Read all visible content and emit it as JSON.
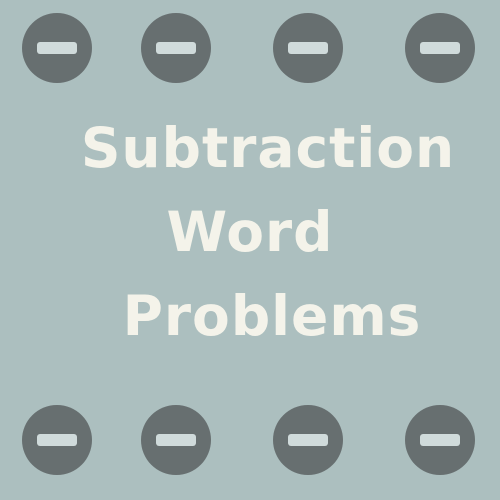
{
  "title": {
    "lines": [
      "Subtraction",
      "Word",
      "Problems"
    ]
  },
  "badges": {
    "icon": "minus-circle-icon",
    "top_row_count": 4,
    "bottom_row_count": 4
  },
  "colors": {
    "background": "#acbfbf",
    "badge_fill": "#676f70",
    "badge_bar": "#d0dbdb",
    "title_text": "#f4f3ea"
  }
}
